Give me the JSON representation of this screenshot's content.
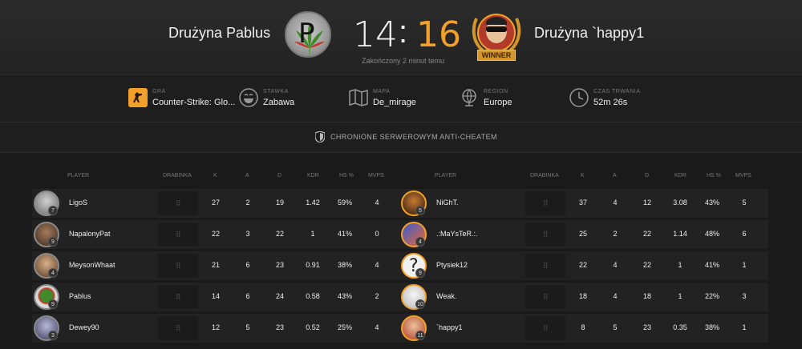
{
  "header": {
    "team_left": "Drużyna Pablus",
    "team_right": "Drużyna `happy1",
    "score_left": "14",
    "score_sep": ":",
    "score_right": "16",
    "status": "Zakończony 2 minut temu",
    "winner_label": "WINNER",
    "left_logo_letter": "P",
    "colors": {
      "accent": "#f2a02a",
      "background": "#1a1a1a"
    }
  },
  "info": {
    "game": {
      "label": "GRA",
      "value": "Counter-Strike: Glo..."
    },
    "stake": {
      "label": "STAWKA",
      "value": "Zabawa"
    },
    "map": {
      "label": "MAPA",
      "value": "De_mirage"
    },
    "region": {
      "label": "REGION",
      "value": "Europe"
    },
    "duration": {
      "label": "CZAS TRWANIA",
      "value": "52m 26s"
    }
  },
  "anticheat": {
    "text": "CHRONIONE SERWEROWYM ANTI-CHEATEM"
  },
  "columns": [
    "PLAYER",
    "DRABINKA",
    "K",
    "A",
    "D",
    "KDR",
    "HS %",
    "MVPS"
  ],
  "teams": {
    "left": [
      {
        "name": "LigoS",
        "level": "7",
        "drabinka": "⠿",
        "k": "27",
        "a": "2",
        "d": "19",
        "kdr": "1.42",
        "hs": "59%",
        "mvps": "4"
      },
      {
        "name": "NapalonyPat",
        "level": "9",
        "drabinka": "⠿",
        "k": "22",
        "a": "3",
        "d": "22",
        "kdr": "1",
        "hs": "41%",
        "mvps": "0"
      },
      {
        "name": "MeysonWhaat",
        "level": "4",
        "drabinka": "⠿",
        "k": "21",
        "a": "6",
        "d": "23",
        "kdr": "0.91",
        "hs": "38%",
        "mvps": "4"
      },
      {
        "name": "Pablus",
        "level": "9",
        "drabinka": "⠿",
        "k": "14",
        "a": "6",
        "d": "24",
        "kdr": "0.58",
        "hs": "43%",
        "mvps": "2"
      },
      {
        "name": "Dewey90",
        "level": "3",
        "drabinka": "⠿",
        "k": "12",
        "a": "5",
        "d": "23",
        "kdr": "0.52",
        "hs": "25%",
        "mvps": "4"
      }
    ],
    "right": [
      {
        "name": "NiGhT.",
        "level": "5",
        "drabinka": "⠿",
        "k": "37",
        "a": "4",
        "d": "12",
        "kdr": "3.08",
        "hs": "43%",
        "mvps": "5"
      },
      {
        "name": ".:MaYsTeR.:.",
        "level": "4",
        "drabinka": "⠿",
        "k": "25",
        "a": "2",
        "d": "22",
        "kdr": "1.14",
        "hs": "48%",
        "mvps": "6"
      },
      {
        "name": "Ptysiek12",
        "level": "9",
        "drabinka": "⠿",
        "k": "22",
        "a": "4",
        "d": "22",
        "kdr": "1",
        "hs": "41%",
        "mvps": "1"
      },
      {
        "name": "Weak.",
        "level": "10",
        "drabinka": "⠿",
        "k": "18",
        "a": "4",
        "d": "18",
        "kdr": "1",
        "hs": "22%",
        "mvps": "3"
      },
      {
        "name": "`happy1",
        "level": "11",
        "drabinka": "⠿",
        "k": "8",
        "a": "5",
        "d": "23",
        "kdr": "0.35",
        "hs": "38%",
        "mvps": "1"
      }
    ]
  }
}
